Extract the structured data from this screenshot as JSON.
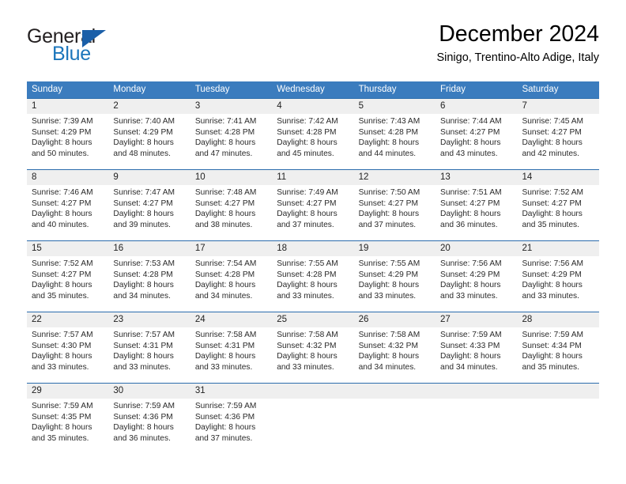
{
  "brand": {
    "name_part1": "General",
    "name_part2": "Blue",
    "triangle_icon": "logo-triangle-icon"
  },
  "header": {
    "title": "December 2024",
    "subtitle": "Sinigo, Trentino-Alto Adige, Italy"
  },
  "colors": {
    "header_blue": "#3b7cbe",
    "separator_blue": "#2b6cad",
    "day_band_gray": "#efefef",
    "brand_blue": "#1b75bb",
    "text_dark": "#222222"
  },
  "weekday_headers": [
    "Sunday",
    "Monday",
    "Tuesday",
    "Wednesday",
    "Thursday",
    "Friday",
    "Saturday"
  ],
  "labels": {
    "sunrise_prefix": "Sunrise:",
    "sunset_prefix": "Sunset:",
    "daylight_prefix": "Daylight:"
  },
  "weeks": [
    {
      "days": [
        {
          "num": "1",
          "sunrise": "Sunrise: 7:39 AM",
          "sunset": "Sunset: 4:29 PM",
          "daylight1": "Daylight: 8 hours",
          "daylight2": "and 50 minutes."
        },
        {
          "num": "2",
          "sunrise": "Sunrise: 7:40 AM",
          "sunset": "Sunset: 4:29 PM",
          "daylight1": "Daylight: 8 hours",
          "daylight2": "and 48 minutes."
        },
        {
          "num": "3",
          "sunrise": "Sunrise: 7:41 AM",
          "sunset": "Sunset: 4:28 PM",
          "daylight1": "Daylight: 8 hours",
          "daylight2": "and 47 minutes."
        },
        {
          "num": "4",
          "sunrise": "Sunrise: 7:42 AM",
          "sunset": "Sunset: 4:28 PM",
          "daylight1": "Daylight: 8 hours",
          "daylight2": "and 45 minutes."
        },
        {
          "num": "5",
          "sunrise": "Sunrise: 7:43 AM",
          "sunset": "Sunset: 4:28 PM",
          "daylight1": "Daylight: 8 hours",
          "daylight2": "and 44 minutes."
        },
        {
          "num": "6",
          "sunrise": "Sunrise: 7:44 AM",
          "sunset": "Sunset: 4:27 PM",
          "daylight1": "Daylight: 8 hours",
          "daylight2": "and 43 minutes."
        },
        {
          "num": "7",
          "sunrise": "Sunrise: 7:45 AM",
          "sunset": "Sunset: 4:27 PM",
          "daylight1": "Daylight: 8 hours",
          "daylight2": "and 42 minutes."
        }
      ]
    },
    {
      "days": [
        {
          "num": "8",
          "sunrise": "Sunrise: 7:46 AM",
          "sunset": "Sunset: 4:27 PM",
          "daylight1": "Daylight: 8 hours",
          "daylight2": "and 40 minutes."
        },
        {
          "num": "9",
          "sunrise": "Sunrise: 7:47 AM",
          "sunset": "Sunset: 4:27 PM",
          "daylight1": "Daylight: 8 hours",
          "daylight2": "and 39 minutes."
        },
        {
          "num": "10",
          "sunrise": "Sunrise: 7:48 AM",
          "sunset": "Sunset: 4:27 PM",
          "daylight1": "Daylight: 8 hours",
          "daylight2": "and 38 minutes."
        },
        {
          "num": "11",
          "sunrise": "Sunrise: 7:49 AM",
          "sunset": "Sunset: 4:27 PM",
          "daylight1": "Daylight: 8 hours",
          "daylight2": "and 37 minutes."
        },
        {
          "num": "12",
          "sunrise": "Sunrise: 7:50 AM",
          "sunset": "Sunset: 4:27 PM",
          "daylight1": "Daylight: 8 hours",
          "daylight2": "and 37 minutes."
        },
        {
          "num": "13",
          "sunrise": "Sunrise: 7:51 AM",
          "sunset": "Sunset: 4:27 PM",
          "daylight1": "Daylight: 8 hours",
          "daylight2": "and 36 minutes."
        },
        {
          "num": "14",
          "sunrise": "Sunrise: 7:52 AM",
          "sunset": "Sunset: 4:27 PM",
          "daylight1": "Daylight: 8 hours",
          "daylight2": "and 35 minutes."
        }
      ]
    },
    {
      "days": [
        {
          "num": "15",
          "sunrise": "Sunrise: 7:52 AM",
          "sunset": "Sunset: 4:27 PM",
          "daylight1": "Daylight: 8 hours",
          "daylight2": "and 35 minutes."
        },
        {
          "num": "16",
          "sunrise": "Sunrise: 7:53 AM",
          "sunset": "Sunset: 4:28 PM",
          "daylight1": "Daylight: 8 hours",
          "daylight2": "and 34 minutes."
        },
        {
          "num": "17",
          "sunrise": "Sunrise: 7:54 AM",
          "sunset": "Sunset: 4:28 PM",
          "daylight1": "Daylight: 8 hours",
          "daylight2": "and 34 minutes."
        },
        {
          "num": "18",
          "sunrise": "Sunrise: 7:55 AM",
          "sunset": "Sunset: 4:28 PM",
          "daylight1": "Daylight: 8 hours",
          "daylight2": "and 33 minutes."
        },
        {
          "num": "19",
          "sunrise": "Sunrise: 7:55 AM",
          "sunset": "Sunset: 4:29 PM",
          "daylight1": "Daylight: 8 hours",
          "daylight2": "and 33 minutes."
        },
        {
          "num": "20",
          "sunrise": "Sunrise: 7:56 AM",
          "sunset": "Sunset: 4:29 PM",
          "daylight1": "Daylight: 8 hours",
          "daylight2": "and 33 minutes."
        },
        {
          "num": "21",
          "sunrise": "Sunrise: 7:56 AM",
          "sunset": "Sunset: 4:29 PM",
          "daylight1": "Daylight: 8 hours",
          "daylight2": "and 33 minutes."
        }
      ]
    },
    {
      "days": [
        {
          "num": "22",
          "sunrise": "Sunrise: 7:57 AM",
          "sunset": "Sunset: 4:30 PM",
          "daylight1": "Daylight: 8 hours",
          "daylight2": "and 33 minutes."
        },
        {
          "num": "23",
          "sunrise": "Sunrise: 7:57 AM",
          "sunset": "Sunset: 4:31 PM",
          "daylight1": "Daylight: 8 hours",
          "daylight2": "and 33 minutes."
        },
        {
          "num": "24",
          "sunrise": "Sunrise: 7:58 AM",
          "sunset": "Sunset: 4:31 PM",
          "daylight1": "Daylight: 8 hours",
          "daylight2": "and 33 minutes."
        },
        {
          "num": "25",
          "sunrise": "Sunrise: 7:58 AM",
          "sunset": "Sunset: 4:32 PM",
          "daylight1": "Daylight: 8 hours",
          "daylight2": "and 33 minutes."
        },
        {
          "num": "26",
          "sunrise": "Sunrise: 7:58 AM",
          "sunset": "Sunset: 4:32 PM",
          "daylight1": "Daylight: 8 hours",
          "daylight2": "and 34 minutes."
        },
        {
          "num": "27",
          "sunrise": "Sunrise: 7:59 AM",
          "sunset": "Sunset: 4:33 PM",
          "daylight1": "Daylight: 8 hours",
          "daylight2": "and 34 minutes."
        },
        {
          "num": "28",
          "sunrise": "Sunrise: 7:59 AM",
          "sunset": "Sunset: 4:34 PM",
          "daylight1": "Daylight: 8 hours",
          "daylight2": "and 35 minutes."
        }
      ]
    },
    {
      "days": [
        {
          "num": "29",
          "sunrise": "Sunrise: 7:59 AM",
          "sunset": "Sunset: 4:35 PM",
          "daylight1": "Daylight: 8 hours",
          "daylight2": "and 35 minutes."
        },
        {
          "num": "30",
          "sunrise": "Sunrise: 7:59 AM",
          "sunset": "Sunset: 4:36 PM",
          "daylight1": "Daylight: 8 hours",
          "daylight2": "and 36 minutes."
        },
        {
          "num": "31",
          "sunrise": "Sunrise: 7:59 AM",
          "sunset": "Sunset: 4:36 PM",
          "daylight1": "Daylight: 8 hours",
          "daylight2": "and 37 minutes."
        },
        {
          "num": "",
          "sunrise": "",
          "sunset": "",
          "daylight1": "",
          "daylight2": ""
        },
        {
          "num": "",
          "sunrise": "",
          "sunset": "",
          "daylight1": "",
          "daylight2": ""
        },
        {
          "num": "",
          "sunrise": "",
          "sunset": "",
          "daylight1": "",
          "daylight2": ""
        },
        {
          "num": "",
          "sunrise": "",
          "sunset": "",
          "daylight1": "",
          "daylight2": ""
        }
      ]
    }
  ]
}
